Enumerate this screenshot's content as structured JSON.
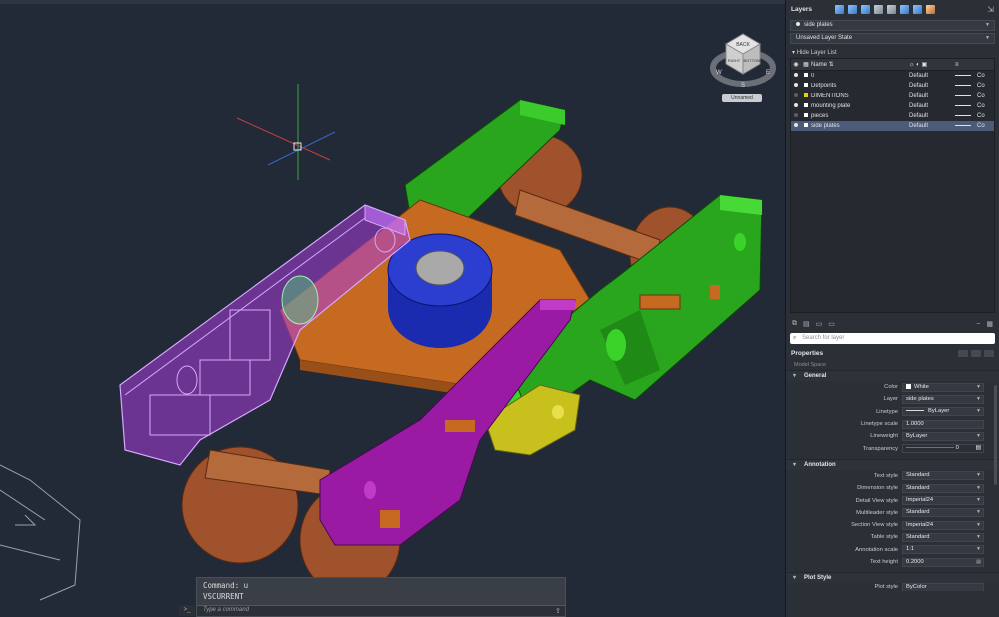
{
  "viewcube": {
    "face_top": "BACK",
    "face_left": "RIGHT",
    "face_right": "BOTTOM",
    "compass_w": "W",
    "compass_s": "S",
    "compass_n": "N",
    "compass_e": "E",
    "label": "Unnamed"
  },
  "command": {
    "history": [
      "Command: u",
      "VSCURRENT"
    ],
    "placeholder": "Type a command",
    "icon": ">_"
  },
  "layers": {
    "title": "Layers",
    "current_layer": "side plates",
    "layer_state": "Unsaved Layer State",
    "hide_list_label": "Hide Layer List",
    "column_name": "Name",
    "rows": [
      {
        "name": "0",
        "linetype": "Default",
        "more": "Co",
        "color": "#ffffff"
      },
      {
        "name": "Defpoints",
        "linetype": "Default",
        "more": "Co",
        "color": "#ffffff"
      },
      {
        "name": "DIMENTIONS",
        "linetype": "Default",
        "more": "Co",
        "color": "#e8d000"
      },
      {
        "name": "mounting plate",
        "linetype": "Default",
        "more": "Co",
        "color": "#ffffff"
      },
      {
        "name": "pieces",
        "linetype": "Default",
        "more": "Co",
        "color": "#ffffff"
      },
      {
        "name": "side plates",
        "linetype": "Default",
        "more": "Co",
        "color": "#ffffff",
        "selected": true
      }
    ],
    "search_placeholder": "Search for layer"
  },
  "properties": {
    "title": "Properties",
    "space": "Model Space",
    "general": {
      "label": "General",
      "color_label": "Color",
      "color": "White",
      "layer_label": "Layer",
      "layer": "side plates",
      "linetype_label": "Linetype",
      "linetype": "ByLayer",
      "ltscale_label": "Linetype scale",
      "ltscale": "1.0000",
      "lineweight_label": "Lineweight",
      "lineweight": "ByLayer",
      "transparency_label": "Transparency",
      "transparency": "0"
    },
    "annotation": {
      "label": "Annotation",
      "rows": [
        {
          "label": "Text style",
          "value": "Standard"
        },
        {
          "label": "Dimension style",
          "value": "Standard"
        },
        {
          "label": "Detail View style",
          "value": "Imperial24"
        },
        {
          "label": "Multileader style",
          "value": "Standard"
        },
        {
          "label": "Section View style",
          "value": "Imperial24"
        },
        {
          "label": "Table style",
          "value": "Standard"
        },
        {
          "label": "Annotation scale",
          "value": "1:1"
        },
        {
          "label": "Text height",
          "value": "0.2000"
        }
      ]
    },
    "plot": {
      "label": "Plot Style",
      "row_label": "Plot style",
      "row_value": "ByColor"
    }
  }
}
